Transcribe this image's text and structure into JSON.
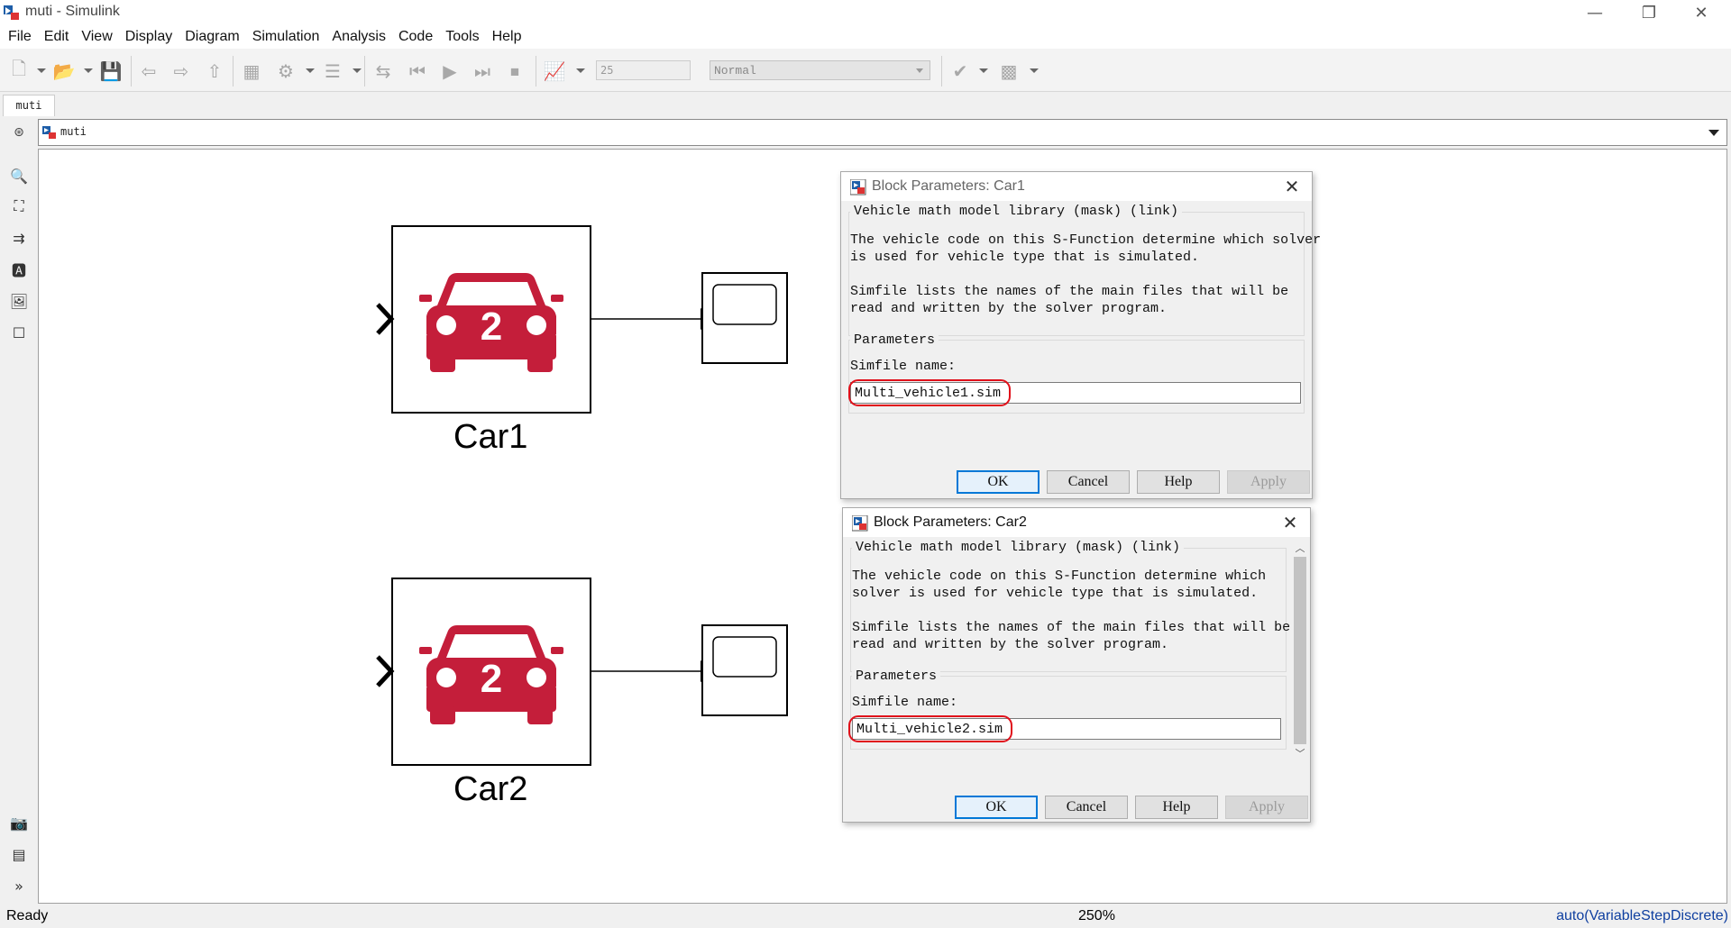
{
  "window": {
    "title": "muti - Simulink",
    "controls": {
      "minimize": "—",
      "restore": "❐",
      "close": "✕"
    }
  },
  "menu": [
    "File",
    "Edit",
    "View",
    "Display",
    "Diagram",
    "Simulation",
    "Analysis",
    "Code",
    "Tools",
    "Help"
  ],
  "toolbar": {
    "stop_time": "25",
    "sim_mode": "Normal",
    "icons": [
      "new-model-icon",
      "open-icon",
      "save-icon",
      "back-icon",
      "forward-icon",
      "up-icon",
      "library-browser-icon",
      "model-config-icon",
      "model-explorer-icon",
      "step-back-icon",
      "run-icon",
      "step-forward-icon",
      "stop-icon",
      "data-inspector-icon",
      "check-icon",
      "build-icon"
    ]
  },
  "tab": {
    "label": "muti"
  },
  "address": {
    "path": "muti"
  },
  "palette": {
    "icons": [
      "zoom-icon",
      "fit-view-icon",
      "arrow-icon",
      "annotation-icon",
      "image-icon",
      "area-icon",
      "screenshot-icon",
      "explorer-bar-icon",
      "expand-icon"
    ]
  },
  "canvas": {
    "blocks": [
      {
        "name": "Car1",
        "badge": "2"
      },
      {
        "name": "Car2",
        "badge": "2"
      }
    ]
  },
  "dialogs": [
    {
      "title": "Block Parameters: Car1",
      "mask_header": "Vehicle math model library (mask) (link)",
      "desc_line1": "The vehicle code on this S-Function determine which solver",
      "desc_line2": "is used for vehicle type that is simulated.",
      "desc_line3": "Simfile lists the names of the main files that will be",
      "desc_line4": "read and written by the solver program.",
      "params_label": "Parameters",
      "field_label": "Simfile name:",
      "field_value": "Multi_vehicle1.sim",
      "buttons": {
        "ok": "OK",
        "cancel": "Cancel",
        "help": "Help",
        "apply": "Apply"
      }
    },
    {
      "title": "Block Parameters: Car2",
      "mask_header": "Vehicle math model library (mask) (link)",
      "desc_line1": "The vehicle code on this S-Function determine which",
      "desc_line2": "solver is used for vehicle type that is simulated.",
      "desc_line3": "Simfile lists the names of the main files that will be",
      "desc_line4": "read and written by the solver program.",
      "params_label": "Parameters",
      "field_label": "Simfile name:",
      "field_value": "Multi_vehicle2.sim",
      "buttons": {
        "ok": "OK",
        "cancel": "Cancel",
        "help": "Help",
        "apply": "Apply"
      }
    }
  ],
  "status": {
    "state": "Ready",
    "zoom": "250%",
    "solver": "auto(VariableStepDiscrete)"
  },
  "colors": {
    "car_red": "#c41e3a",
    "highlight_red": "#e0101a",
    "accent_blue": "#0078d7"
  }
}
